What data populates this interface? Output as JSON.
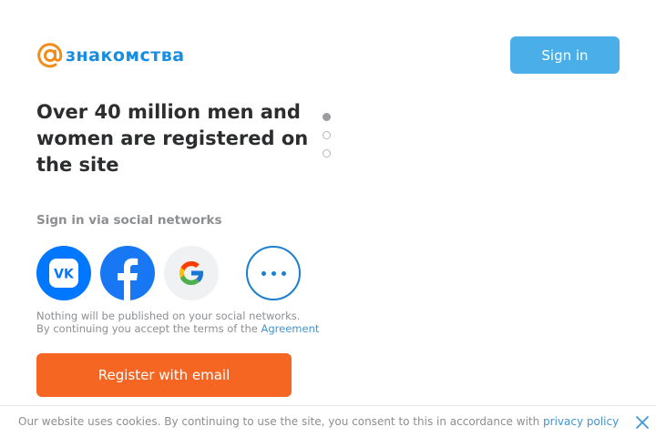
{
  "header": {
    "logo_text": "знакомства",
    "signin_label": "Sign in"
  },
  "hero": {
    "headline": "Over 40 million men and women are registered on the site",
    "carousel": {
      "slides": 3,
      "active_index": 0
    }
  },
  "social": {
    "heading": "Sign in via social networks",
    "buttons": [
      {
        "name": "vk",
        "icon": "vk-icon"
      },
      {
        "name": "facebook",
        "icon": "facebook-icon"
      },
      {
        "name": "google",
        "icon": "google-icon"
      },
      {
        "name": "more",
        "icon": "more-icon"
      }
    ],
    "note_line1": "Nothing will be published on your social networks.",
    "note_line2_prefix": "By continuing you accept the terms of the ",
    "agreement_link": "Agreement"
  },
  "register": {
    "label": "Register with email"
  },
  "cookie_bar": {
    "text": "Our website uses cookies. By continuing to use the site, you consent to this in accordance with ",
    "policy_link": "privacy policy"
  },
  "colors": {
    "brand_blue": "#168de2",
    "signin_bg": "#4aaee8",
    "register_bg": "#f46622",
    "vk": "#0077ff",
    "facebook": "#1877f2",
    "link": "#3f96d2"
  }
}
